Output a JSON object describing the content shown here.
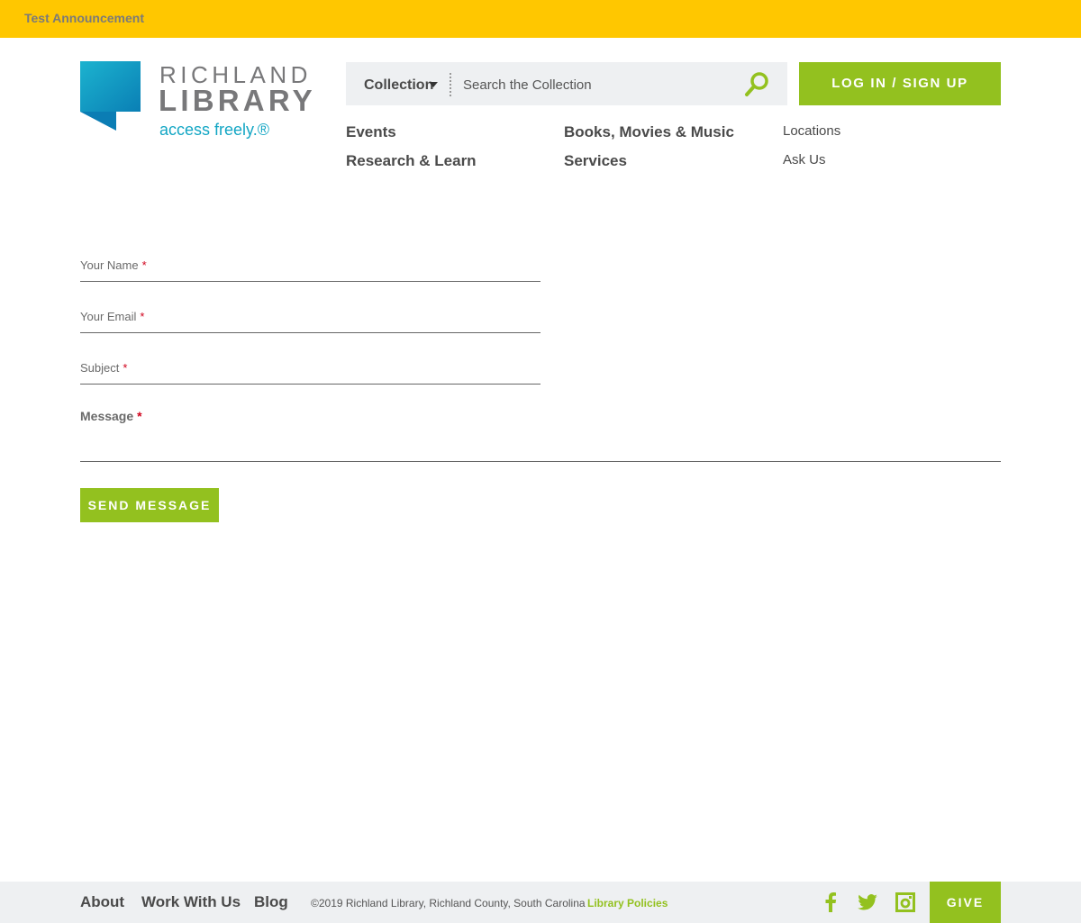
{
  "announcement": {
    "text": "Test Announcement"
  },
  "logo": {
    "line1": "RICHLAND",
    "line2": "LIBRARY",
    "tagline": "access freely.®"
  },
  "search": {
    "scope": "Collection",
    "placeholder": "Search the Collection",
    "icon": "search-icon"
  },
  "header": {
    "login_label": "LOG IN / SIGN UP"
  },
  "nav": {
    "col1": [
      "Events",
      "Research & Learn"
    ],
    "col2": [
      "Books, Movies & Music",
      "Services"
    ],
    "col3": [
      "Locations",
      "Ask Us"
    ]
  },
  "form": {
    "name_label": "Your Name",
    "email_label": "Your Email",
    "subject_label": "Subject",
    "message_label": "Message",
    "required_mark": "*",
    "send_label": "SEND MESSAGE"
  },
  "footer": {
    "links": [
      "About",
      "Work With Us",
      "Blog"
    ],
    "copyright": "©2019 Richland Library, Richland County, South Carolina",
    "policies": "Library Policies",
    "give_label": "GIVE",
    "social_icons": [
      "facebook-icon",
      "twitter-icon",
      "instagram-icon"
    ]
  },
  "colors": {
    "announcement": "#ffc700",
    "accent": "#93c11f",
    "brand_blue": "#13a6c4",
    "footer_bg": "#eef0f2"
  }
}
